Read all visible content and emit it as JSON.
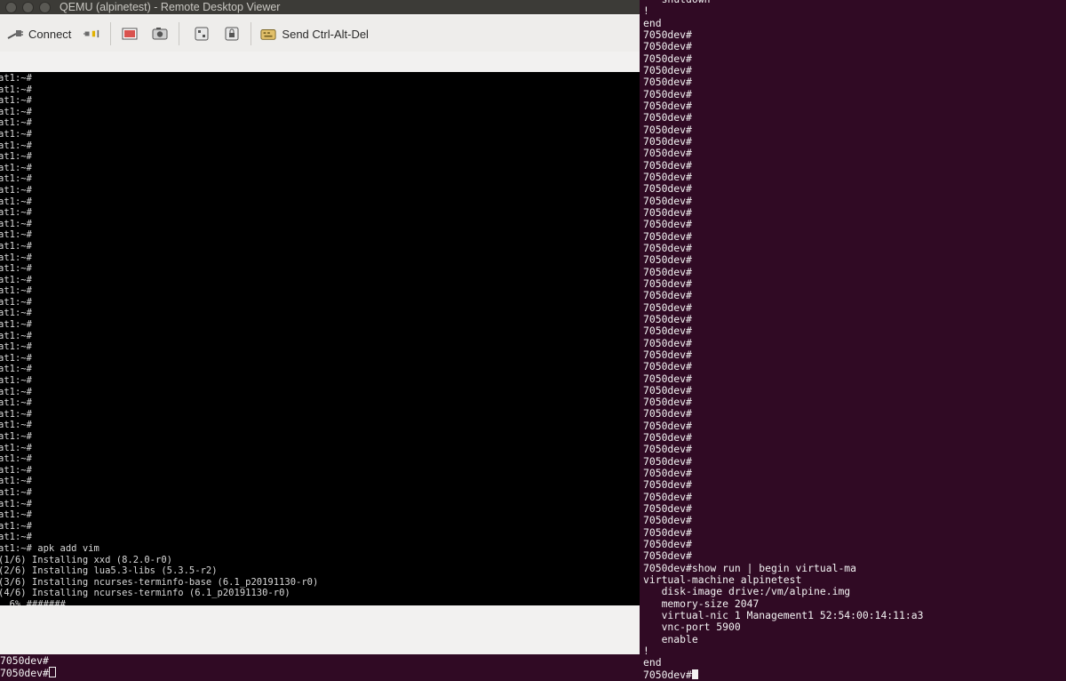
{
  "window": {
    "title": "QEMU (alpinetest) - Remote Desktop Viewer"
  },
  "toolbar": {
    "connect_label": "Connect",
    "send_keys_label": "Send Ctrl-Alt-Del",
    "icons": [
      "connect-icon",
      "disconnect-icon",
      "fullscreen-icon",
      "screenshot-icon",
      "scaling-icon",
      "keyboard-grab-icon",
      "send-keys-icon"
    ]
  },
  "guest_console": {
    "prompt": "at1:~#",
    "prompt_line_count": 42,
    "output_lines": [
      "at1:~# apk add vim",
      "(1/6) Installing xxd (8.2.0-r0)",
      "(2/6) Installing lua5.3-libs (5.3.5-r2)",
      "(3/6) Installing ncurses-terminfo-base (6.1_p20191130-r0)",
      "(4/6) Installing ncurses-terminfo (6.1_p20191130-r0)",
      "  6% #######"
    ]
  },
  "right_terminal": {
    "lines": [
      "   shutdown",
      "!",
      "end",
      "7050dev#",
      "7050dev#",
      "7050dev#",
      "7050dev#",
      "7050dev#",
      "7050dev#",
      "7050dev#",
      "7050dev#",
      "7050dev#",
      "7050dev#",
      "7050dev#",
      "7050dev#",
      "7050dev#",
      "7050dev#",
      "7050dev#",
      "7050dev#",
      "7050dev#",
      "7050dev#",
      "7050dev#",
      "7050dev#",
      "7050dev#",
      "7050dev#",
      "7050dev#",
      "7050dev#",
      "7050dev#",
      "7050dev#",
      "7050dev#",
      "7050dev#",
      "7050dev#",
      "7050dev#",
      "7050dev#",
      "7050dev#",
      "7050dev#",
      "7050dev#",
      "7050dev#",
      "7050dev#",
      "7050dev#",
      "7050dev#",
      "7050dev#",
      "7050dev#",
      "7050dev#",
      "7050dev#",
      "7050dev#",
      "7050dev#",
      "7050dev#",
      "7050dev#show run | begin virtual-ma",
      "virtual-machine alpinetest",
      "   disk-image drive:/vm/alpine.img",
      "   memory-size 2047",
      "   virtual-nic 1 Management1 52:54:00:14:11:a3",
      "   vnc-port 5900",
      "   enable",
      "!",
      "end"
    ],
    "prompt_last": "7050dev#"
  },
  "left_terminal_bottom": {
    "lines": [
      "7050dev#",
      "7050dev#"
    ]
  },
  "colors": {
    "terminal_bg": "#300a24",
    "titlebar_bg": "#3c3b37",
    "toolbar_bg": "#eeedeb",
    "console_bg": "#000000"
  }
}
